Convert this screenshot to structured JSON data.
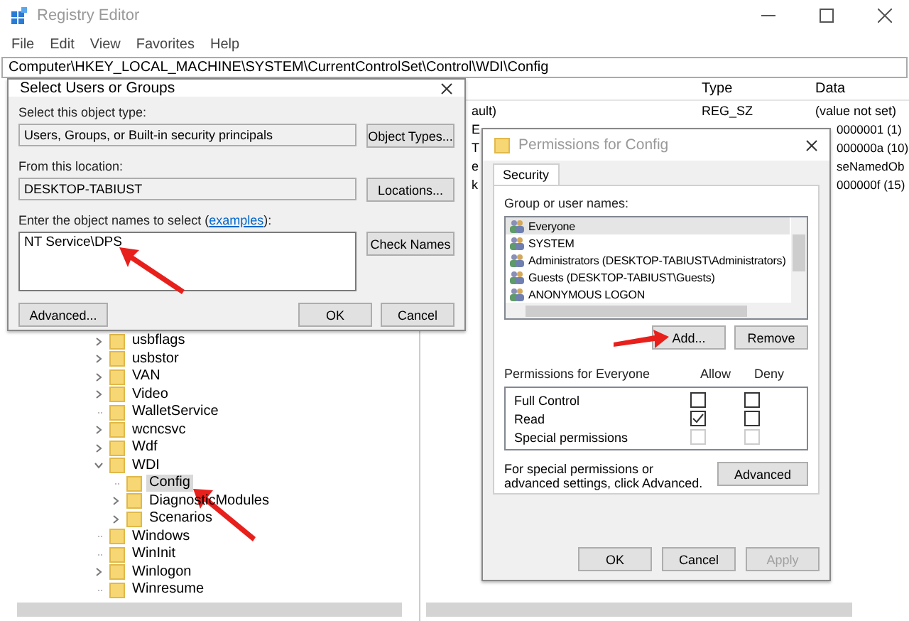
{
  "window": {
    "title": "Registry Editor"
  },
  "menu": [
    "File",
    "Edit",
    "View",
    "Favorites",
    "Help"
  ],
  "address": "Computer\\HKEY_LOCAL_MACHINE\\SYSTEM\\CurrentControlSet\\Control\\WDI\\Config",
  "tree": [
    {
      "label": "usbflags",
      "expandable": true,
      "expanded": false,
      "selected": false
    },
    {
      "label": "usbstor",
      "expandable": true,
      "expanded": false,
      "selected": false
    },
    {
      "label": "VAN",
      "expandable": true,
      "expanded": false,
      "selected": false
    },
    {
      "label": "Video",
      "expandable": true,
      "expanded": false,
      "selected": false
    },
    {
      "label": "WalletService",
      "expandable": false,
      "selected": false
    },
    {
      "label": "wcncsvc",
      "expandable": true,
      "expanded": false,
      "selected": false
    },
    {
      "label": "Wdf",
      "expandable": true,
      "expanded": false,
      "selected": false
    },
    {
      "label": "WDI",
      "expandable": true,
      "expanded": true,
      "selected": false,
      "children": [
        {
          "label": "Config",
          "expandable": false,
          "selected": true
        },
        {
          "label": "DiagnosticModules",
          "expandable": true,
          "expanded": false,
          "selected": false
        },
        {
          "label": "Scenarios",
          "expandable": true,
          "expanded": false,
          "selected": false
        }
      ]
    },
    {
      "label": "Windows",
      "expandable": false,
      "selected": false
    },
    {
      "label": "WinInit",
      "expandable": false,
      "selected": false
    },
    {
      "label": "Winlogon",
      "expandable": true,
      "expanded": false,
      "selected": false
    },
    {
      "label": "Winresume",
      "expandable": false,
      "selected": false
    }
  ],
  "list": {
    "columns": [
      "Type",
      "Data"
    ],
    "rows": [
      {
        "name": "ault)",
        "type": "REG_SZ",
        "data": "(value not set)"
      },
      {
        "name": "E",
        "data": "0000001 (1)"
      },
      {
        "name": "T",
        "data": "000000a (10)"
      },
      {
        "name": "e",
        "data": "seNamedOb"
      },
      {
        "name": "k",
        "data": "000000f (15)"
      }
    ]
  },
  "select_dialog": {
    "title": "Select Users or Groups",
    "object_type_label": "Select this object type:",
    "object_type": "Users, Groups, or Built-in security principals",
    "object_types_button": "Object Types...",
    "location_label": "From this location:",
    "location": "DESKTOP-TABIUST",
    "locations_button": "Locations...",
    "names_label": "Enter the object names to select (",
    "names_link": "examples",
    "names_label_end": "):",
    "names_value": "NT Service\\DPS",
    "check_names_button": "Check Names",
    "buttons": [
      {
        "label": "Advanced...",
        "kind": "left"
      },
      {
        "label": "OK",
        "kind": "right"
      },
      {
        "label": "Cancel",
        "kind": "right"
      }
    ]
  },
  "permissions_dialog": {
    "title": "Permissions for Config",
    "tab": {
      "label": "Security",
      "selected": true
    },
    "group_label": "Group or user names:",
    "users": [
      {
        "name": "Everyone",
        "selected": true
      },
      {
        "name": "SYSTEM",
        "selected": false
      },
      {
        "name": "Administrators (DESKTOP-TABIUST\\Administrators)",
        "selected": false
      },
      {
        "name": "Guests (DESKTOP-TABIUST\\Guests)",
        "selected": false
      },
      {
        "name": "ANONYMOUS LOGON",
        "selected": false
      }
    ],
    "add_button": "Add...",
    "remove_button": "Remove",
    "permissions_label": "Permissions for Everyone",
    "allow_label": "Allow",
    "deny_label": "Deny",
    "permissions": [
      {
        "name": "Full Control",
        "allow": {
          "checked": false,
          "disabled": false
        },
        "deny": {
          "checked": false,
          "disabled": false
        }
      },
      {
        "name": "Read",
        "allow": {
          "checked": true,
          "disabled": false
        },
        "deny": {
          "checked": false,
          "disabled": false
        }
      },
      {
        "name": "Special permissions",
        "allow": {
          "checked": false,
          "disabled": true
        },
        "deny": {
          "checked": false,
          "disabled": true
        }
      }
    ],
    "advanced_note": "For special permissions or advanced settings, click Advanced.",
    "advanced_button": "Advanced",
    "buttons": [
      {
        "label": "OK",
        "disabled": false
      },
      {
        "label": "Cancel",
        "disabled": false
      },
      {
        "label": "Apply",
        "disabled": true
      }
    ]
  }
}
